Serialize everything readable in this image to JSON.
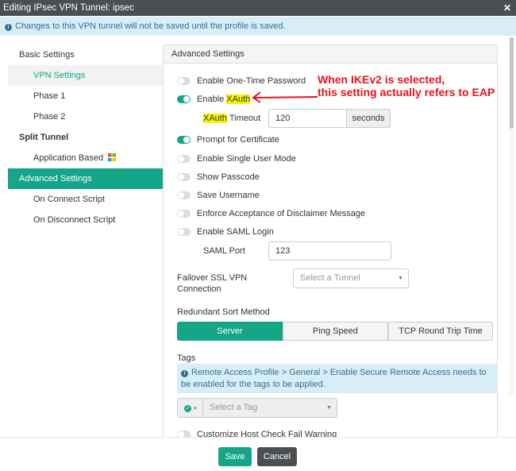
{
  "title": "Editing IPsec VPN Tunnel: ipsec",
  "info": "Changes to this VPN tunnel will not be saved until the profile is saved.",
  "sidebar": [
    {
      "label": "Basic Settings"
    },
    {
      "label": "VPN Settings"
    },
    {
      "label": "Phase 1"
    },
    {
      "label": "Phase 2"
    },
    {
      "label": "Split Tunnel"
    },
    {
      "label": "Application Based"
    },
    {
      "label": "Advanced Settings"
    },
    {
      "label": "On Connect Script"
    },
    {
      "label": "On Disconnect Script"
    }
  ],
  "panel": {
    "title": "Advanced Settings",
    "otp": "Enable One-Time Password",
    "xauth_prefix": "Enable ",
    "xauth_hl": "XAuth",
    "timeout_hl": "XAuth",
    "timeout_label": " Timeout",
    "timeout_value": "120",
    "timeout_unit": "seconds",
    "prompt_cert": "Prompt for Certificate",
    "single_user": "Enable Single User Mode",
    "show_passcode": "Show Passcode",
    "save_username": "Save Username",
    "disclaimer": "Enforce Acceptance of Disclaimer Message",
    "saml": "Enable SAML Login",
    "saml_port_label": "SAML Port",
    "saml_port_value": "123",
    "failover_label": "Failover SSL VPN Connection",
    "failover_placeholder": "Select a Tunnel",
    "sort_label": "Redundant Sort Method",
    "sort_options": [
      "Server",
      "Ping Speed",
      "TCP Round Trip Time"
    ],
    "tags_label": "Tags",
    "tags_info": "Remote Access Profile > General > Enable Secure Remote Access needs to be enabled for the tags to be applied.",
    "tag_placeholder": "Select a Tag",
    "host_check": "Customize Host Check Fail Warning"
  },
  "annotation": {
    "line1": "When IKEv2 is selected,",
    "line2": "this setting actually refers to EAP"
  },
  "footer": {
    "save": "Save",
    "cancel": "Cancel"
  },
  "colors": {
    "accent": "#15a589",
    "annotation": "#e8141b"
  }
}
